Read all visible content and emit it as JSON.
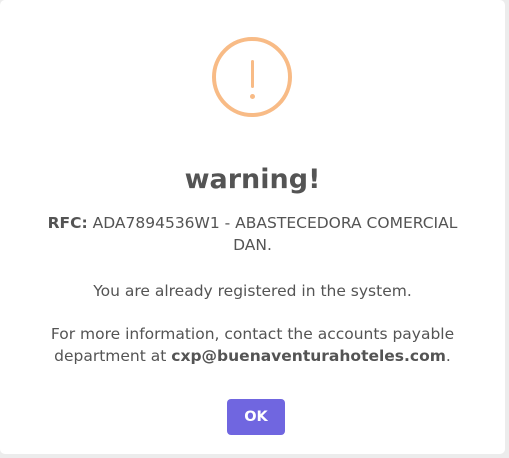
{
  "dialog": {
    "icon": "exclamation-icon",
    "title": "warning!",
    "rfc_label": "RFC:",
    "rfc_value": " ADA7894536W1 - ABASTECEDORA COMERCIAL DAN.",
    "registered_message": "You are already registered in the system.",
    "info_prefix": "For more information, contact the accounts payable department at ",
    "info_email": "cxp@buenaventurahoteles.com",
    "info_suffix": ".",
    "ok_label": "OK"
  },
  "colors": {
    "warning_icon": "#f8bb86",
    "confirm_button": "#7066e0",
    "text": "#545454"
  }
}
